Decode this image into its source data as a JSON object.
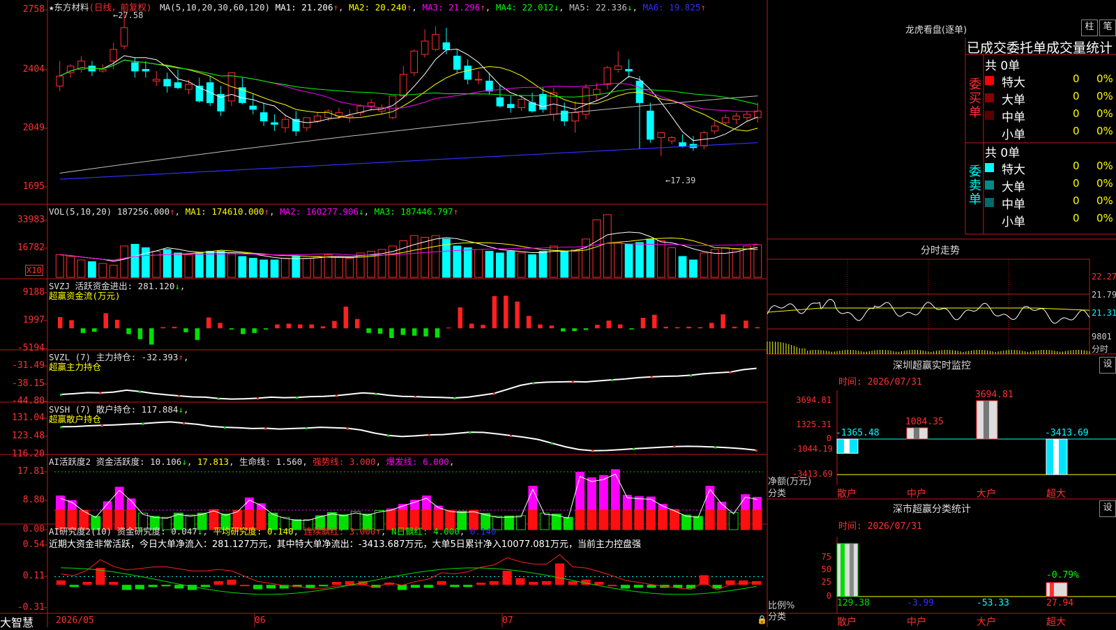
{
  "app": {
    "brand": "大智慧"
  },
  "main_pane": {
    "stock_name": "★东方材料",
    "period": "(日线，前复权)",
    "ma_label": "MA(5,10,20,30,60,120)",
    "ma_values": [
      {
        "label": "MA1: 21.206",
        "arrow": "↑",
        "color": "#ffffff"
      },
      {
        "label": "MA2: 20.240",
        "arrow": "↑",
        "color": "#ffff00"
      },
      {
        "label": "MA3: 21.296",
        "arrow": "↑",
        "color": "#ff00ff"
      },
      {
        "label": "MA4: 22.012",
        "arrow": "↓",
        "color": "#00ff00"
      },
      {
        "label": "MA5: 22.336",
        "arrow": "↓",
        "color": "#c0c0c0"
      },
      {
        "label": "MA6: 19.825",
        "arrow": "↑",
        "color": "#3030ff"
      }
    ],
    "y_ticks": [
      "2758",
      "2404",
      "2049",
      "1695"
    ],
    "high_label": "←27.58",
    "low_label": "←17.39"
  },
  "vol_pane": {
    "title": "VOL(5,10,20)",
    "value": "187256.000",
    "ma1": "MA1: 174610.000",
    "ma2": "MA2: 160277.906",
    "ma3": "MA3: 187446.797",
    "y_ticks": [
      "33983",
      "16782"
    ],
    "unit": "X10"
  },
  "svzj_pane": {
    "title": "SVZJ  活跃资金进出: 281.120",
    "subtitle": "超赢资金流(万元)",
    "y_ticks": [
      "9188",
      "1997",
      "-5194"
    ]
  },
  "svzl_pane": {
    "title": "SVZL (7) 主力持仓: -32.393",
    "subtitle": "超赢主力持仓",
    "y_ticks": [
      "-31.49",
      "-38.15",
      "-44.80"
    ]
  },
  "svsh_pane": {
    "title": "SVSH (7) 散户持仓: 117.884",
    "subtitle": "超赢散户持仓",
    "y_ticks": [
      "131.04",
      "123.48",
      "116.20"
    ]
  },
  "ai_active_pane": {
    "title_a": "AI活跃度2 资金活跃度: 10.106",
    "title_b": "17.813",
    "title_c": "生命线: 1.560",
    "title_d": "强势线: 3.000",
    "title_e": "爆发线: 6.000",
    "y_ticks": [
      "17.81",
      "8.80",
      "0.00"
    ]
  },
  "ai_research_pane": {
    "title_a": "AI研究度2(10) 资金研究度: 0.047",
    "title_b": "平均研究度: 0.140",
    "title_c": "连续飘红: 3.000",
    "title_d": "N日飘红: 4.000",
    "title_e": "0.140",
    "note": "近期大资金非常活跃，今日大单净流入：281.127万元，其中特大单净流出：-3413.687万元，大单5日累计净入10077.081万元，当前主力控盘强",
    "y_ticks": [
      "0.54",
      "0.11",
      "-0.31"
    ]
  },
  "x_axis": {
    "labels": [
      "2026/05",
      "06",
      "07"
    ]
  },
  "right_panel": {
    "lhb_title": "龙虎看盘(逐单)",
    "btn_zhu": "柱",
    "btn_bi": "笔",
    "stat_title": "已成交委托单成交量统计",
    "buy_side": {
      "label": "委买单",
      "total": "共 0单",
      "rows": [
        {
          "name": "特大",
          "count": "0",
          "pct": "0%",
          "color": "#ff0000"
        },
        {
          "name": "大单",
          "count": "0",
          "pct": "0%",
          "color": "#8b0000"
        },
        {
          "name": "中单",
          "count": "0",
          "pct": "0%",
          "color": "#5a0000"
        },
        {
          "name": "小单",
          "count": "0",
          "pct": "0%",
          "color": "#000000"
        }
      ]
    },
    "sell_side": {
      "label": "委卖单",
      "total": "共 0单",
      "rows": [
        {
          "name": "特大",
          "count": "0",
          "pct": "0%",
          "color": "#00ffff"
        },
        {
          "name": "大单",
          "count": "0",
          "pct": "0%",
          "color": "#008b8b"
        },
        {
          "name": "中单",
          "count": "0",
          "pct": "0%",
          "color": "#006b6b"
        },
        {
          "name": "小单",
          "count": "0",
          "pct": "0%",
          "color": "#000000"
        }
      ]
    },
    "intraday": {
      "title": "分时走势",
      "y_ticks": [
        "22.27",
        "21.79",
        "21.31"
      ],
      "vol_label": "9801",
      "vol_unit": "分时"
    },
    "sz_monitor": {
      "title": "深圳超赢实时监控",
      "btn": "设",
      "time": "时间: 2026/07/31",
      "y_ticks": [
        "3694.81",
        "1325.31",
        "0",
        "-1044.19",
        "-3413.69"
      ],
      "ylabel": "净额(万元)",
      "xlabel": "分类",
      "categories": [
        "散户",
        "中户",
        "大户",
        "超大"
      ],
      "values": [
        "-1365.48",
        "1084.35",
        "3694.81",
        "-3413.69"
      ]
    },
    "sz_class": {
      "title": "深市超赢分类统计",
      "btn": "设",
      "time": "时间: 2026/07/31",
      "y_ticks": [
        "75",
        "50",
        "25",
        "0"
      ],
      "ylabel": "比例%",
      "xlabel": "分类",
      "categories": [
        "散户",
        "中户",
        "大户",
        "超大"
      ],
      "values": [
        "129.38",
        "-3.99",
        "-53.33",
        "27.94"
      ],
      "top_label": "-0.79%"
    }
  },
  "chart_data": [
    {
      "type": "candlestick",
      "title": "东方材料 日线 前复权",
      "categories": [
        "2026/05",
        "06",
        "07"
      ],
      "ylim": [
        1695,
        2758
      ],
      "series": [
        {
          "name": "K",
          "values": [
            [
              2300,
              2450,
              2360,
              2270
            ],
            [
              2380,
              2430,
              2420,
              2350
            ],
            [
              2400,
              2480,
              2450,
              2380
            ],
            [
              2420,
              2450,
              2390,
              2360
            ],
            [
              2390,
              2430,
              2400,
              2380
            ],
            [
              2450,
              2560,
              2520,
              2400
            ],
            [
              2540,
              2758,
              2650,
              2520
            ],
            [
              2440,
              2470,
              2390,
              2350
            ],
            [
              2400,
              2450,
              2390,
              2350
            ],
            [
              2330,
              2390,
              2340,
              2300
            ],
            [
              2340,
              2380,
              2300,
              2260
            ],
            [
              2320,
              2400,
              2290,
              2280
            ],
            [
              2280,
              2340,
              2310,
              2250
            ],
            [
              2300,
              2350,
              2210,
              2200
            ],
            [
              2320,
              2360,
              2200,
              2180
            ],
            [
              2250,
              2300,
              2150,
              2120
            ],
            [
              2210,
              2340,
              2380,
              2180
            ],
            [
              2290,
              2350,
              2200,
              2190
            ],
            [
              2180,
              2250,
              2160,
              2130
            ],
            [
              2140,
              2200,
              2090,
              2060
            ],
            [
              2080,
              2130,
              2070,
              2030
            ],
            [
              2050,
              2130,
              2100,
              2020
            ],
            [
              2100,
              2150,
              2030,
              2000
            ],
            [
              2050,
              2100,
              2110,
              2030
            ],
            [
              2090,
              2140,
              2120,
              2080
            ],
            [
              2110,
              2160,
              2150,
              2090
            ],
            [
              2120,
              2170,
              2140,
              2100
            ],
            [
              2110,
              2160,
              2120,
              2080
            ],
            [
              2140,
              2190,
              2180,
              2120
            ],
            [
              2180,
              2220,
              2200,
              2150
            ],
            [
              2150,
              2190,
              2170,
              2130
            ],
            [
              2110,
              2230,
              2240,
              2100
            ],
            [
              2240,
              2420,
              2370,
              2230
            ],
            [
              2380,
              2520,
              2510,
              2360
            ],
            [
              2490,
              2640,
              2570,
              2470
            ],
            [
              2520,
              2660,
              2610,
              2510
            ],
            [
              2560,
              2650,
              2520,
              2490
            ],
            [
              2480,
              2520,
              2400,
              2380
            ],
            [
              2420,
              2460,
              2340,
              2310
            ],
            [
              2340,
              2390,
              2340,
              2310
            ],
            [
              2330,
              2380,
              2270,
              2250
            ],
            [
              2230,
              2310,
              2180,
              2170
            ],
            [
              2190,
              2240,
              2170,
              2140
            ],
            [
              2170,
              2240,
              2220,
              2150
            ],
            [
              2200,
              2260,
              2150,
              2140
            ],
            [
              2250,
              2290,
              2160,
              2140
            ],
            [
              2130,
              2290,
              2260,
              2090
            ],
            [
              2150,
              2200,
              2090,
              2060
            ],
            [
              2090,
              2210,
              2140,
              2020
            ],
            [
              2130,
              2310,
              2290,
              2100
            ],
            [
              2250,
              2320,
              2280,
              2210
            ],
            [
              2310,
              2420,
              2410,
              2280
            ],
            [
              2400,
              2510,
              2420,
              2380
            ],
            [
              2400,
              2460,
              2390,
              2350
            ],
            [
              2330,
              2360,
              2200,
              1920
            ],
            [
              2150,
              2200,
              1980,
              1960
            ],
            [
              1990,
              2020,
              2020,
              1880
            ],
            [
              1970,
              2000,
              1990,
              1950
            ],
            [
              1960,
              2010,
              1940,
              1930
            ],
            [
              1950,
              2000,
              1930,
              1910
            ],
            [
              1940,
              2030,
              2020,
              1920
            ],
            [
              2030,
              2090,
              2060,
              2010
            ],
            [
              2080,
              2130,
              2110,
              2060
            ],
            [
              2100,
              2140,
              2120,
              2070
            ],
            [
              2110,
              2150,
              2130,
              2090
            ],
            [
              2110,
              2200,
              2150,
              2080
            ]
          ]
        }
      ]
    },
    {
      "type": "bar",
      "title": "VOL(5,10,20)",
      "ylim": [
        0,
        33983
      ],
      "series": [
        {
          "name": "VOL",
          "values": [
            13000,
            12000,
            10000,
            9000,
            8000,
            7000,
            18000,
            19000,
            17000,
            15000,
            16000,
            14000,
            13000,
            14000,
            15000,
            15000,
            14000,
            12000,
            11000,
            10000,
            10000,
            11000,
            12000,
            11000,
            12000,
            13000,
            12000,
            11000,
            14000,
            15000,
            16000,
            18000,
            21000,
            24000,
            23000,
            24000,
            22000,
            18000,
            17000,
            16000,
            15000,
            14000,
            15000,
            14000,
            13000,
            15000,
            18000,
            15000,
            16000,
            22000,
            33000,
            36000,
            20000,
            19000,
            20000,
            22000,
            21000,
            17000,
            12000,
            10000,
            14000,
            16000,
            17000,
            16000,
            18000,
            18726
          ]
        }
      ]
    },
    {
      "type": "bar",
      "title": "超赢资金流(万元)",
      "ylim": [
        -5194,
        9188
      ],
      "series": [
        {
          "name": "SVZJ",
          "values": [
            2900,
            2100,
            -1200,
            -900,
            3900,
            2200,
            -1500,
            -2800,
            -4200,
            300,
            400,
            -1000,
            -3000,
            2800,
            1400,
            -300,
            -1500,
            -1200,
            -300,
            1000,
            1200,
            1000,
            1000,
            500,
            1900,
            5600,
            2400,
            -1200,
            -1400,
            -2500,
            -1700,
            -1900,
            -2100,
            -2400,
            200,
            5400,
            1200,
            900,
            8300,
            8400,
            6900,
            3200,
            1000,
            700,
            -800,
            -700,
            -400,
            900,
            2000,
            1000,
            -300,
            2700,
            3500,
            400,
            300,
            400,
            300,
            1400,
            3600,
            400,
            2000,
            300
          ]
        }
      ]
    },
    {
      "type": "line",
      "title": "超赢主力持仓",
      "ylim": [
        -44.8,
        -31.49
      ],
      "series": [
        {
          "name": "SVZL",
          "values": [
            -42.2,
            -41.9,
            -41.5,
            -41.6,
            -41.3,
            -40.6,
            -41.1,
            -41.8,
            -42.3,
            -42.7,
            -43.1,
            -43.2,
            -43.7,
            -43.9,
            -43.8,
            -43.6,
            -43.2,
            -43.4,
            -43.3,
            -43.0,
            -42.9,
            -42.6,
            -42.1,
            -41.6,
            -41.9,
            -42.5,
            -42.9,
            -43.0,
            -43.2,
            -43.3,
            -43.5,
            -43.2,
            -42.5,
            -41.8,
            -40.3,
            -38.8,
            -37.9,
            -37.6,
            -37.5,
            -37.4,
            -37.5,
            -37.1,
            -36.7,
            -36.4,
            -35.9,
            -35.6,
            -35.4,
            -35.3,
            -35.0,
            -34.4,
            -34.1,
            -33.8,
            -32.9,
            -32.4
          ]
        }
      ]
    },
    {
      "type": "line",
      "title": "超赢散户持仓",
      "ylim": [
        116.2,
        131.04
      ],
      "series": [
        {
          "name": "SVSH",
          "values": [
            127.5,
            127.6,
            127.9,
            128.1,
            128.3,
            128.6,
            128.8,
            129.2,
            129.5,
            129.0,
            128.5,
            127.7,
            127.3,
            127.1,
            126.8,
            126.9,
            126.6,
            126.8,
            127.0,
            127.3,
            127.1,
            126.9,
            126.2,
            124.9,
            124.0,
            123.5,
            123.8,
            124.2,
            124.3,
            124.8,
            125.3,
            125.2,
            124.6,
            123.9,
            123.2,
            122.3,
            120.8,
            119.3,
            118.2,
            117.7,
            117.8,
            118.1,
            118.5,
            118.8,
            119.1,
            119.4,
            119.5,
            119.4,
            119.2,
            118.9,
            118.5,
            117.9
          ]
        }
      ]
    },
    {
      "type": "bar",
      "title": "AI活跃度2",
      "ylim": [
        0,
        17.81
      ],
      "series": [
        {
          "name": "资金活跃度",
          "values": [
            10.5,
            9.1,
            6.1,
            4.1,
            8.7,
            13.2,
            9.6,
            5.1,
            4.1,
            3.8,
            5.1,
            4.5,
            5.1,
            6.3,
            4.8,
            6.0,
            9.9,
            8.1,
            5.1,
            3.8,
            3.1,
            3.1,
            4.3,
            5.3,
            4.6,
            5.6,
            4.8,
            5.9,
            6.5,
            7.9,
            9.2,
            10.5,
            7.4,
            6.1,
            5.7,
            6.0,
            5.0,
            4.1,
            4.2,
            4.3,
            13.5,
            5.1,
            4.8,
            3.8,
            17.8,
            16.1,
            16.8,
            18.6,
            10.7,
            10.3,
            10.2,
            7.9,
            6.3,
            4.5,
            4.1,
            13.5,
            8.6,
            5.3,
            10.9,
            10.1
          ]
        }
      ]
    },
    {
      "type": "bar",
      "title": "AI研究度2(10)",
      "ylim": [
        -0.31,
        0.54
      ],
      "series": [
        {
          "name": "资金研究度",
          "values": [
            0.06,
            -0.03,
            0.04,
            0.23,
            0.04,
            -0.07,
            -0.06,
            -0.03,
            -0.02,
            -0.05,
            -0.07,
            -0.03,
            0.05,
            0.07,
            0.0,
            -0.06,
            -0.05,
            -0.05,
            -0.03,
            -0.04,
            -0.02,
            0.04,
            0.05,
            0.05,
            -0.04,
            0.03,
            -0.07,
            -0.04,
            -0.04,
            0.05,
            -0.03,
            -0.03,
            0.03,
            0.05,
            0.19,
            0.09,
            0.04,
            0.05,
            0.29,
            0.05,
            0.07,
            0.04,
            0.0,
            -0.05,
            -0.04,
            -0.04,
            -0.04,
            -0.04,
            -0.05,
            0.13,
            -0.05,
            0.06,
            0.06,
            0.05
          ]
        }
      ]
    }
  ]
}
